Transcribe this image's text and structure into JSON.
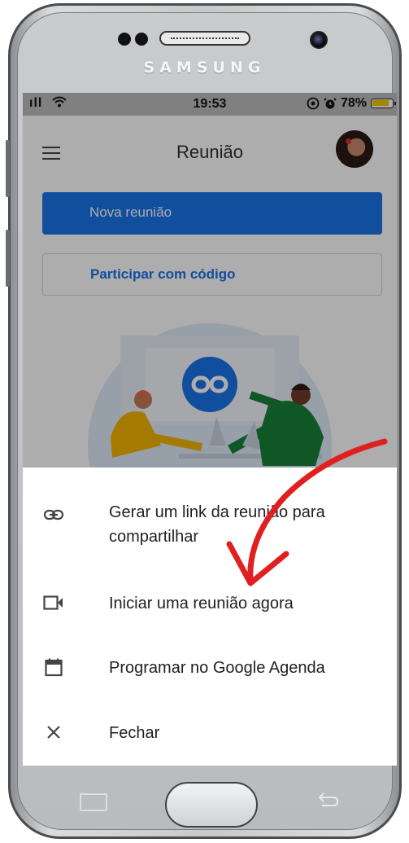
{
  "device": {
    "brand": "SAMSUNG"
  },
  "status_bar": {
    "signal": "ıll",
    "time": "19:53",
    "icons": [
      "vpn-icon",
      "alarm-icon"
    ],
    "battery": "78%"
  },
  "app": {
    "title": "Reunião",
    "new_meeting_label": "Nova reunião",
    "join_label": "Participar com código"
  },
  "sheet": {
    "items": [
      {
        "icon": "link-icon",
        "label": "Gerar um link da reunião para compartilhar"
      },
      {
        "icon": "video-camera-icon",
        "label": "Iniciar uma reunião agora"
      },
      {
        "icon": "calendar-icon",
        "label": "Programar no Google Agenda"
      },
      {
        "icon": "close-icon",
        "label": "Fechar"
      }
    ]
  },
  "colors": {
    "primary": "#1a73e8",
    "annotation_arrow": "#e02020",
    "battery": "#f5c400"
  }
}
